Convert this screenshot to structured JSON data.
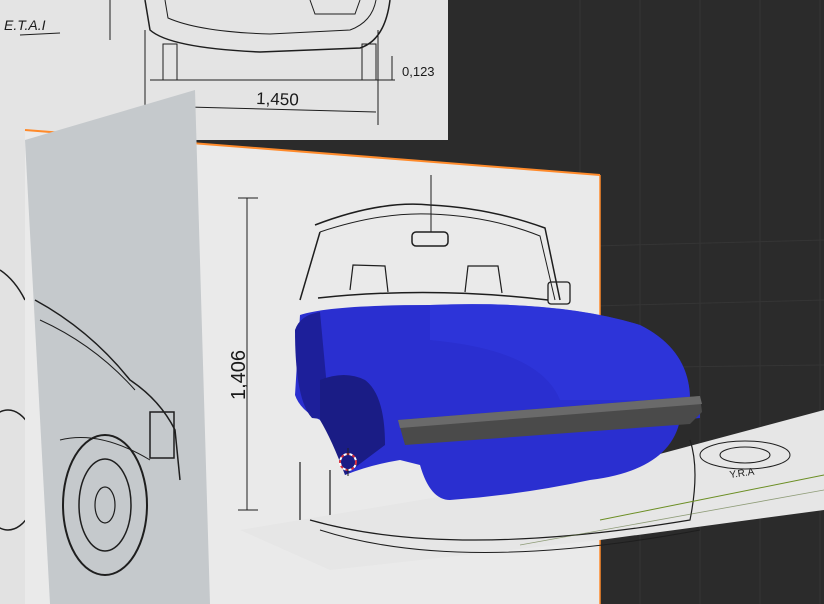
{
  "scene": {
    "colors": {
      "viewport_bg": "#2b2b2b",
      "grid_line": "#3a3a3a",
      "blueprint_paper": "#e9e9e9",
      "blueprint_ink": "#1e1e1e",
      "side_panel": "#c4c8cb",
      "selection_outline": "#ff8a2a",
      "car_body": "#2a2fd0",
      "car_body_dark": "#1d1f9a",
      "bumper": "#4a4a4a",
      "axis_green": "#6b8e23",
      "cursor_red": "#d63040"
    },
    "dimension_labels": {
      "width_label": "1,450",
      "height_label": "1,406",
      "ground_clearance_label": "0,123",
      "corner_label": "E.T.A.I",
      "small_label": "Y.R.A"
    },
    "icons": {
      "cursor": "3d-cursor-icon"
    }
  }
}
